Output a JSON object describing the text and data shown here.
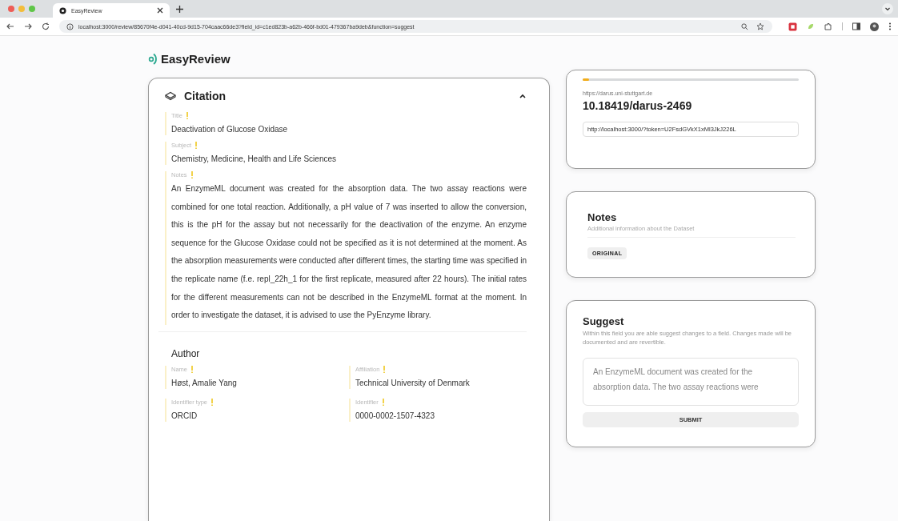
{
  "browser": {
    "tab_title": "EasyReview",
    "url": "localhost:3000/review/85670f4e-d041-40cd-9d15-704caac66de3?field_id=c1ed823b-a62b-466f-bd01-479367ba9deb&function=suggest"
  },
  "brand": "EasyReview",
  "citation": {
    "title": "Citation",
    "expanded": true,
    "fields": [
      {
        "label": "Title",
        "value": "Deactivation of Glucose Oxidase"
      },
      {
        "label": "Subject",
        "value": "Chemistry, Medicine, Health and Life Sciences"
      },
      {
        "label": "Notes",
        "value": "An EnzymeML document was created for the absorption data. The two assay reactions were combined for one total reaction. Additionally, a pH value of 7 was inserted to allow the conversion, this is the pH for the assay but not necessarily for the deactivation of the enzyme. An enzyme sequence for the Glucose Oxidase could not be specified as it is not determined at the moment. As the absorption measurements were conducted after different times, the starting time was specified in the replicate name (f.e. repl_22h_1 for the first replicate, measured after 22 hours). The initial rates for the different measurements can not be described in the EnzymeML format at the moment. In order to investigate the dataset, it is advised to use the PyEnzyme library."
      }
    ],
    "author": {
      "heading": "Author",
      "fields": [
        {
          "label": "Name",
          "value": "Høst, Amalie Yang"
        },
        {
          "label": "Affiliation",
          "value": "Technical University of Denmark"
        },
        {
          "label": "Identifier type",
          "value": "ORCID"
        },
        {
          "label": "Identifier",
          "value": "0000-0002-1507-4323"
        }
      ]
    }
  },
  "dataset": {
    "progress": {
      "level": 0.03
    },
    "repository": "https://darus.uni-stuttgart.de",
    "doi": "10.18419/darus-2469",
    "share_link": "http://localhost:3000/?token=U2FsdGVkX1xMl3JkJ226L"
  },
  "notes": {
    "title": "Notes",
    "subtitle": "Additional information about the Dataset",
    "tag": "ORIGINAL"
  },
  "suggest": {
    "title": "Suggest",
    "description": "Within this field you are able suggest changes to a field. Changes made will be documented and are revertible.",
    "value": "An EnzymeML document was created for the absorption data. The two assay reactions were",
    "button": "SUBMIT"
  }
}
